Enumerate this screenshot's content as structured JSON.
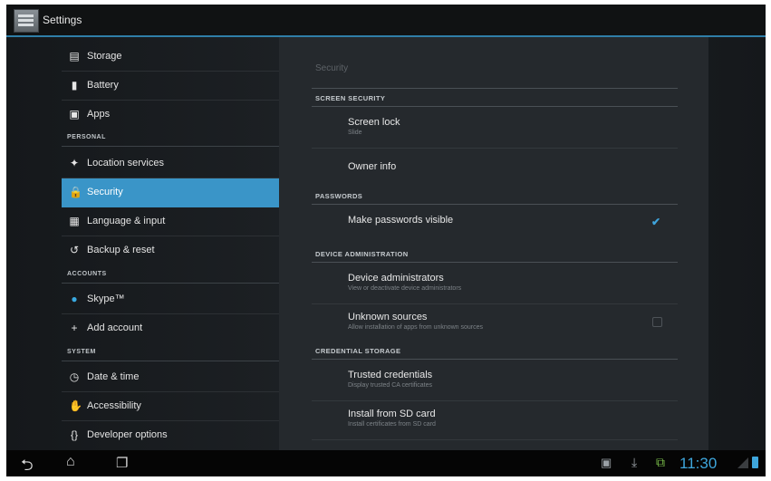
{
  "action_bar": {
    "title": "Settings"
  },
  "nav": {
    "items": [
      {
        "id": "storage",
        "label": "Storage",
        "icon": "storage-icon"
      },
      {
        "id": "battery",
        "label": "Battery",
        "icon": "battery-icon"
      },
      {
        "id": "apps",
        "label": "Apps",
        "icon": "apps-icon"
      },
      {
        "id": "location",
        "label": "Location services",
        "icon": "location-icon"
      },
      {
        "id": "security",
        "label": "Security",
        "icon": "lock-icon",
        "selected": true
      },
      {
        "id": "language",
        "label": "Language & input",
        "icon": "keyboard-icon"
      },
      {
        "id": "backup",
        "label": "Backup & reset",
        "icon": "backup-icon"
      },
      {
        "id": "skype",
        "label": "Skype™",
        "icon": "skype-icon"
      },
      {
        "id": "add-account",
        "label": "Add account",
        "icon": "plus-icon"
      },
      {
        "id": "date-time",
        "label": "Date & time",
        "icon": "clock-icon"
      },
      {
        "id": "accessibility",
        "label": "Accessibility",
        "icon": "accessibility-icon"
      },
      {
        "id": "developer",
        "label": "Developer options",
        "icon": "braces-icon"
      }
    ],
    "headers": {
      "personal": "PERSONAL",
      "accounts": "ACCOUNTS",
      "system": "SYSTEM"
    }
  },
  "detail": {
    "title": "Security",
    "sections": {
      "screen_security": "SCREEN SECURITY",
      "passwords": "PASSWORDS",
      "device_admin": "DEVICE ADMINISTRATION",
      "credential_storage": "CREDENTIAL STORAGE"
    },
    "prefs": {
      "screen_lock": {
        "title": "Screen lock",
        "summary": "Slide"
      },
      "owner_info": {
        "title": "Owner info"
      },
      "make_passwords_visible": {
        "title": "Make passwords visible",
        "checked": true
      },
      "device_administrators": {
        "title": "Device administrators",
        "summary": "View or deactivate device administrators"
      },
      "unknown_sources": {
        "title": "Unknown sources",
        "summary": "Allow installation of apps from unknown sources",
        "checked": false
      },
      "trusted_credentials": {
        "title": "Trusted credentials",
        "summary": "Display trusted CA certificates"
      },
      "install_from_sd": {
        "title": "Install from SD card",
        "summary": "Install certificates from SD card"
      }
    }
  },
  "system_bar": {
    "clock": "11:30",
    "icons": [
      "back-icon",
      "home-icon",
      "recents-icon",
      "gallery-icon",
      "download-icon",
      "usb-icon",
      "signal-icon",
      "battery-status-icon"
    ]
  },
  "colors": {
    "accent": "#3a95c8",
    "clock": "#3ea6dc"
  }
}
